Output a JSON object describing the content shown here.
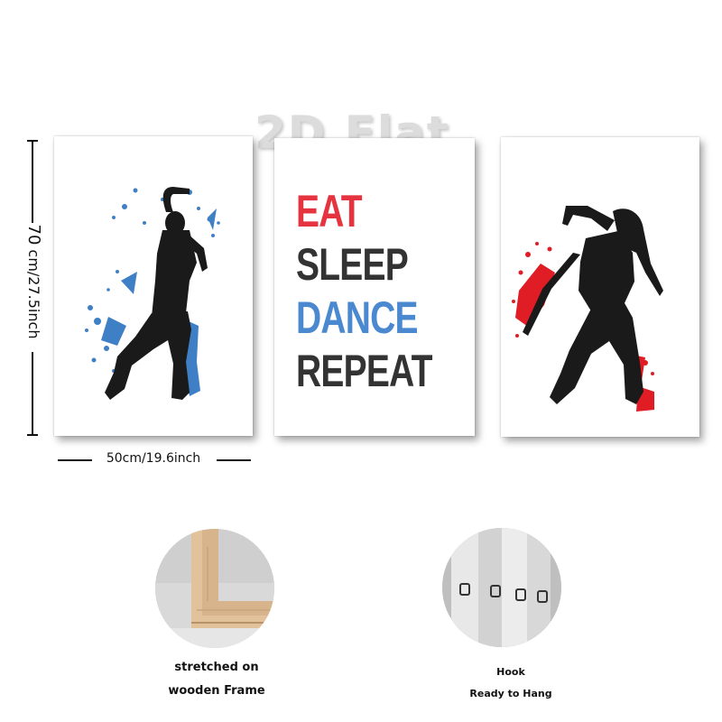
{
  "watermark": "2D Flat",
  "slogan": {
    "line1": "EAT",
    "line2": "SLEEP",
    "line3": "DANCE",
    "line4": "REPEAT"
  },
  "colors": {
    "red": "#e53440",
    "dark": "#333333",
    "blue": "#4a88d0",
    "splash_blue": "#3f7fc6",
    "splash_red": "#e01c24"
  },
  "dimensions": {
    "height_value": "70",
    "height_unit": "cm/27.5inch",
    "width_label": "50cm/19.6inch"
  },
  "details": {
    "frame_caption_1": "stretched on",
    "frame_caption_2": "wooden Frame",
    "hook_caption_1": "Hook",
    "hook_caption_2": "Ready to Hang"
  }
}
